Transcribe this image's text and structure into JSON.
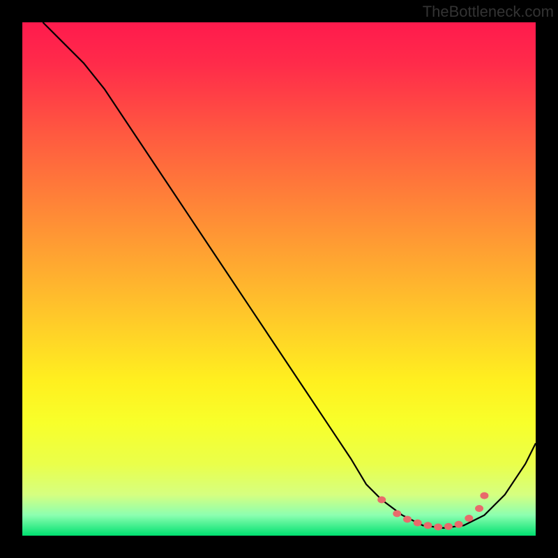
{
  "watermark": "TheBottleneck.com",
  "chart_data": {
    "type": "line",
    "title": "",
    "xlabel": "",
    "ylabel": "",
    "xlim": [
      0,
      100
    ],
    "ylim": [
      0,
      100
    ],
    "series": [
      {
        "name": "curve",
        "x": [
          4,
          8,
          12,
          16,
          20,
          24,
          28,
          32,
          36,
          40,
          44,
          48,
          52,
          56,
          60,
          64,
          67,
          70,
          74,
          78,
          82,
          86,
          90,
          94,
          98,
          100
        ],
        "y": [
          100,
          96,
          92,
          87,
          81,
          75,
          69,
          63,
          57,
          51,
          45,
          39,
          33,
          27,
          21,
          15,
          10,
          7,
          4,
          2,
          1.5,
          2,
          4,
          8,
          14,
          18
        ]
      }
    ],
    "markers": {
      "name": "highlight-dots",
      "x": [
        70,
        73,
        75,
        77,
        79,
        81,
        83,
        85,
        87,
        89,
        90
      ],
      "y": [
        7,
        4.3,
        3.2,
        2.5,
        2.0,
        1.7,
        1.8,
        2.2,
        3.4,
        5.3,
        7.8
      ]
    }
  },
  "colors": {
    "background": "#000000",
    "curve": "#000000",
    "dots": "#e86b6b",
    "watermark": "#333333"
  }
}
